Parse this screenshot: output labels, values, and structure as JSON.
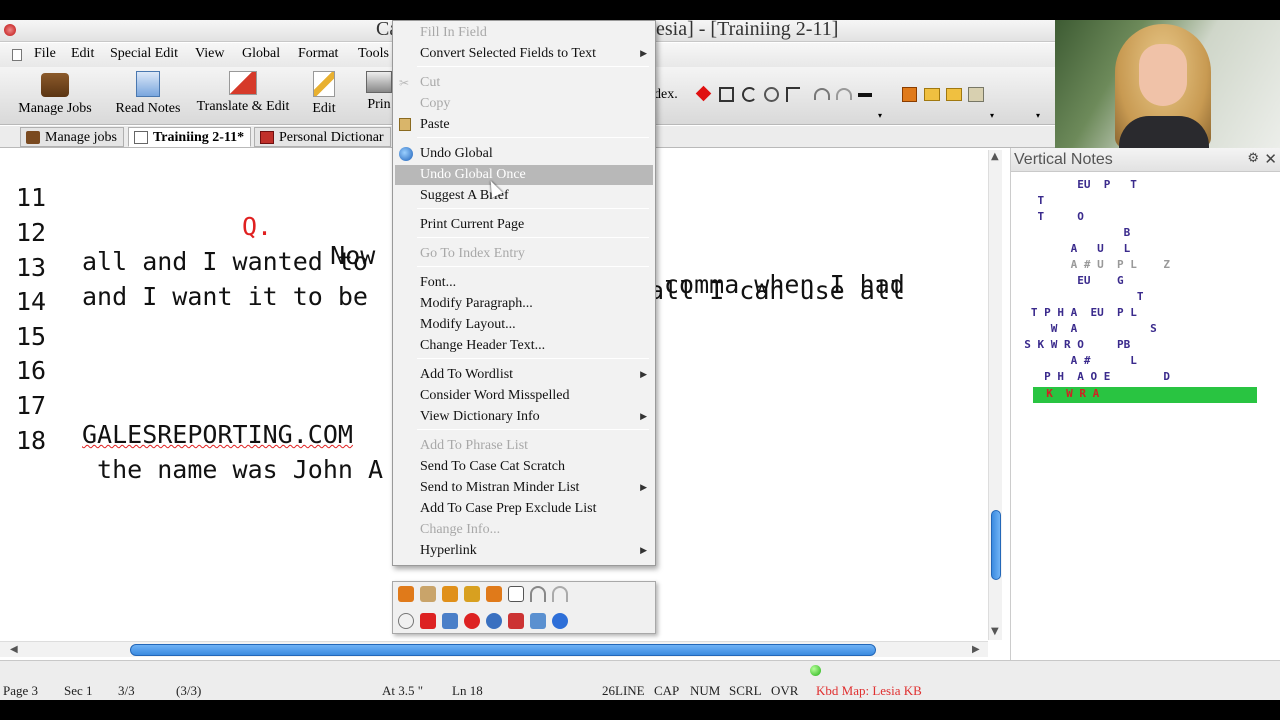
{
  "title": "Ca... [Lesia] - [Trainiing 2-11]",
  "title_left": "Ca",
  "title_right": "esia] - [Trainiing 2-11]",
  "menu": [
    {
      "label": "File"
    },
    {
      "label": "Edit"
    },
    {
      "label": "Special Edit"
    },
    {
      "label": "View"
    },
    {
      "label": "Global"
    },
    {
      "label": "Format"
    },
    {
      "label": "Tools"
    }
  ],
  "toolbar": {
    "manage_jobs": "Manage Jobs",
    "read_notes": "Read Notes",
    "translate_edit": "Translate & Edit",
    "edit": "Edit",
    "print": "Prin",
    "index_partial": "dex."
  },
  "doc_tabs": {
    "manage_jobs": "Manage jobs",
    "training": "Trainiing 2-11*",
    "personal_dictionary": "Personal Dictionar"
  },
  "editor_lines": [
    {
      "num": "11",
      "pre": "       ",
      "q": "Q.",
      "text": "   Now ",
      "right": "comma when I had"
    },
    {
      "num": "12",
      "text": "all and I wanted to ",
      "right": "all I can use all"
    },
    {
      "num": "13",
      "text": "and I want it to be ",
      "right": ""
    },
    {
      "num": "14",
      "text": "",
      "right": ""
    },
    {
      "num": "15",
      "text": "",
      "right": ""
    },
    {
      "num": "16",
      "text": "",
      "right": ""
    },
    {
      "num": "17",
      "text": "GALESREPORTING.COM",
      "right": ""
    },
    {
      "num": "18",
      "text": " the name was John A",
      "right": ""
    }
  ],
  "context_menu": {
    "fill_in_field": "Fill In Field",
    "convert_fields": "Convert Selected Fields to Text",
    "cut": "Cut",
    "copy": "Copy",
    "paste": "Paste",
    "undo_global": "Undo Global",
    "undo_global_once": "Undo Global Once",
    "suggest_brief": "Suggest A Brief",
    "print_current_page": "Print Current Page",
    "go_to_index": "Go To Index Entry",
    "font": "Font...",
    "modify_paragraph": "Modify Paragraph...",
    "modify_layout": "Modify Layout...",
    "change_header": "Change Header Text...",
    "add_wordlist": "Add To Wordlist",
    "consider_misspelled": "Consider Word Misspelled",
    "view_dictionary": "View Dictionary Info",
    "add_phrase": "Add To Phrase List",
    "send_case_cat": "Send To Case Cat Scratch",
    "send_mistran": "Send to Mistran Minder List",
    "add_case_prep": "Add To Case Prep Exclude List",
    "change_info": "Change Info...",
    "hyperlink": "Hyperlink"
  },
  "vertical_notes": {
    "title": "Vertical Notes",
    "lines": [
      "          EU  P   T",
      "    T",
      "    T     O",
      "                 B",
      "         A   U   L",
      "         A # U  P L    Z",
      "          EU    G",
      "                   T",
      "   T P H A  EU  P L",
      "      W  A           S",
      "  S K W R O     PB",
      "         A #      L",
      "     P H  A O E        D",
      "  K  W R A"
    ]
  },
  "status": {
    "page": "Page 3",
    "sec": "Sec 1",
    "pages": "3/3",
    "pages_paren": "(3/3)",
    "at": "At  3.5 \"",
    "ln": "Ln  18",
    "lines": "26LINE",
    "cap": "CAP",
    "num": "NUM",
    "scrl": "SCRL",
    "ovr": "OVR",
    "kbd": "Kbd Map: Lesia KB"
  },
  "colors": {
    "accent_blue": "#3b8be0",
    "selected_menu": "#b8b8b8",
    "steno_highlight": "#29c441",
    "question_red": "#e02020",
    "steno_text": "#3a2a8c"
  }
}
